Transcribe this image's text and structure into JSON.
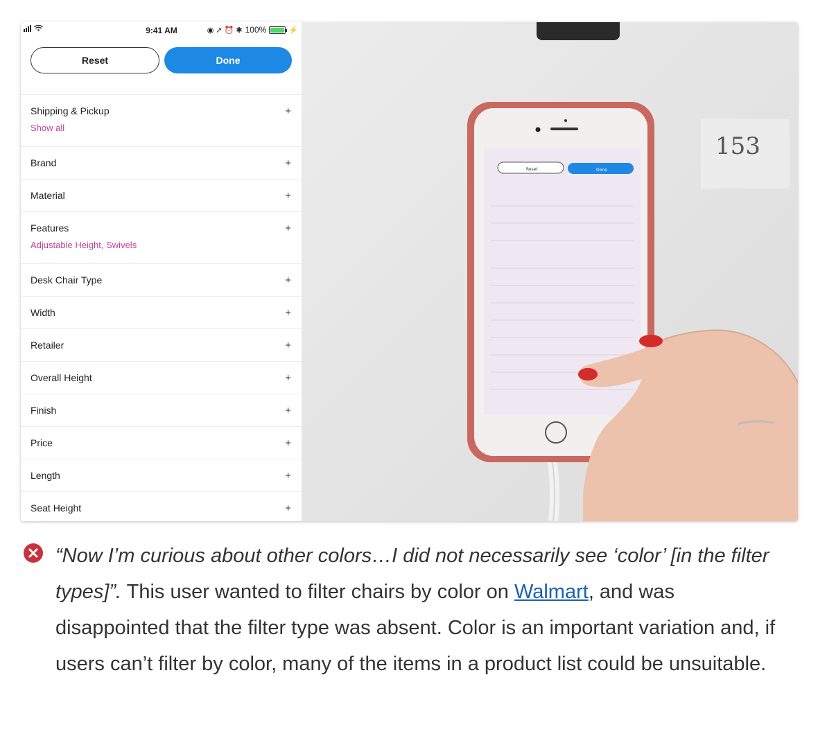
{
  "phone": {
    "status": {
      "time": "9:41 AM",
      "battery": "100%"
    },
    "reset_label": "Reset",
    "done_label": "Done",
    "filters": [
      {
        "label": "Shipping & Pickup",
        "sub": "Show all"
      },
      {
        "label": "Brand"
      },
      {
        "label": "Material"
      },
      {
        "label": "Features",
        "sub": "Adjustable Height, Swivels"
      },
      {
        "label": "Desk Chair Type"
      },
      {
        "label": "Width"
      },
      {
        "label": "Retailer"
      },
      {
        "label": "Overall Height"
      },
      {
        "label": "Finish"
      },
      {
        "label": "Price"
      },
      {
        "label": "Length"
      },
      {
        "label": "Seat Height"
      }
    ],
    "plus_symbol": "+",
    "accent": "#1e88e5",
    "sub_color": "#c2409f"
  },
  "photo": {
    "note": "153",
    "mini_reset": "Reset",
    "mini_done": "Done"
  },
  "caption": {
    "quote": "“Now I’m curious about other colors…I did not necessarily see ‘color’ [in the filter types]”.",
    "text1": " This user wanted to filter chairs by color on ",
    "link": "Walmart",
    "text2": ", and was disappointed that the filter type was absent. Color is an important variation and, if users can’t filter by color, many of the items in a product list could be unsuitable.",
    "icon": "close-circle-icon",
    "icon_color": "#c8323c"
  }
}
